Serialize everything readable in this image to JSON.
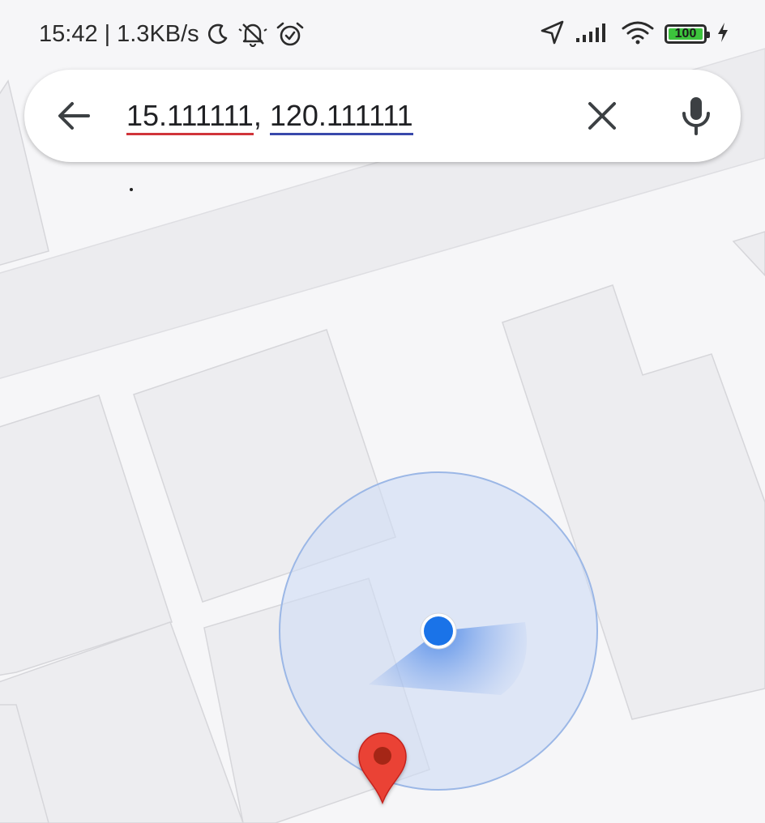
{
  "status_bar": {
    "time": "15:42",
    "separator": "|",
    "net_speed": "1.3KB/s",
    "icons_left": [
      "moon-icon",
      "bell-muted-icon",
      "alarm-icon"
    ],
    "icons_right": [
      "location-arrow-icon",
      "signal-icon",
      "wifi-icon",
      "battery-icon",
      "charging-icon"
    ],
    "battery_level": "100",
    "battery_color": "#3cc43c"
  },
  "search": {
    "latitude": "15.111111",
    "separator": ",",
    "longitude": "120.111111",
    "back_icon": "arrow-left-icon",
    "clear_icon": "close-icon",
    "mic_icon": "microphone-icon"
  },
  "map": {
    "accuracy_circle_color": "#cfdcf5",
    "location_dot_color": "#1a73e8",
    "pin_color": "#ea4335",
    "pin_center_color": "#a52714",
    "map_icons": [
      "location-dot-icon",
      "map-pin-icon"
    ]
  }
}
